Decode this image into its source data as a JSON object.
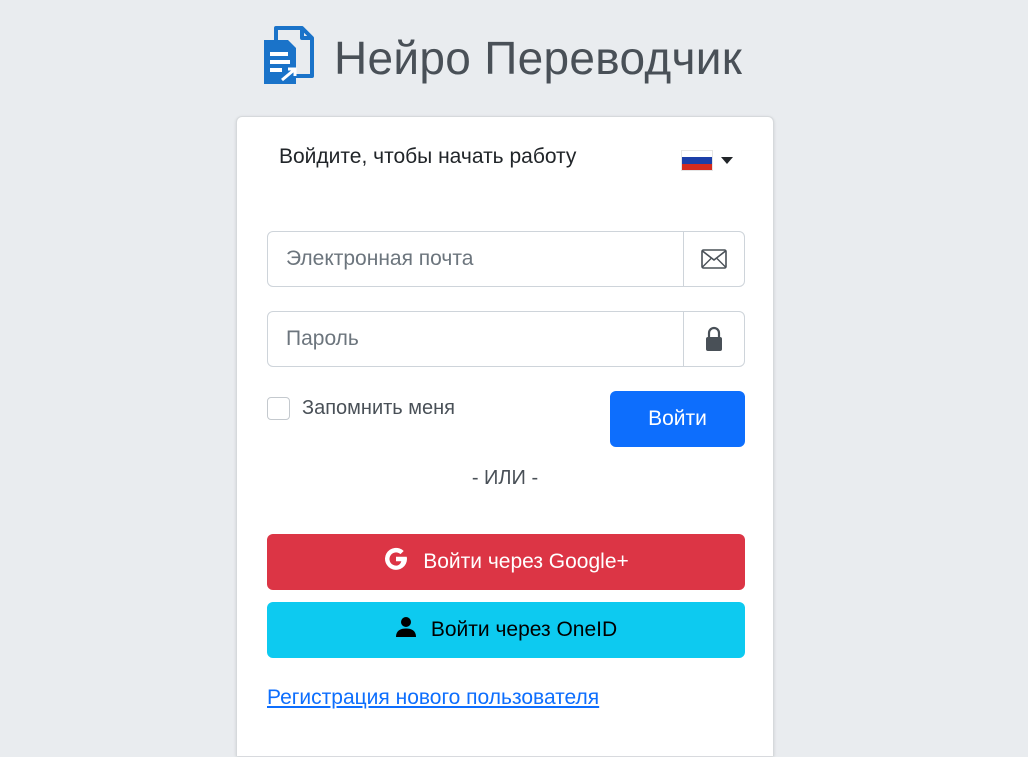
{
  "brand": {
    "title": "Нейро Переводчик",
    "logo_icon": "document-translate-icon",
    "logo_color": "#1a73c9"
  },
  "login": {
    "message": "Войдите, чтобы начать работу",
    "language": {
      "flag": "russia-flag-icon",
      "flag_colors": [
        "#ffffff",
        "#1c3fa8",
        "#d52b1e"
      ]
    },
    "email": {
      "placeholder": "Электронная почта",
      "value": "",
      "icon": "envelope-icon"
    },
    "password": {
      "placeholder": "Пароль",
      "value": "",
      "icon": "lock-icon"
    },
    "remember_label": "Запомнить меня",
    "remember_checked": false,
    "submit_label": "Войти",
    "separator": "- ИЛИ -",
    "google_label": "Войти через Google+",
    "google_icon": "google-icon",
    "oneid_label": "Войти через OneID",
    "oneid_icon": "user-icon",
    "register_link": "Регистрация нового пользователя"
  },
  "colors": {
    "primary": "#0d6efd",
    "danger": "#dc3545",
    "info": "#0dcaf0",
    "background": "#e9ecef"
  }
}
